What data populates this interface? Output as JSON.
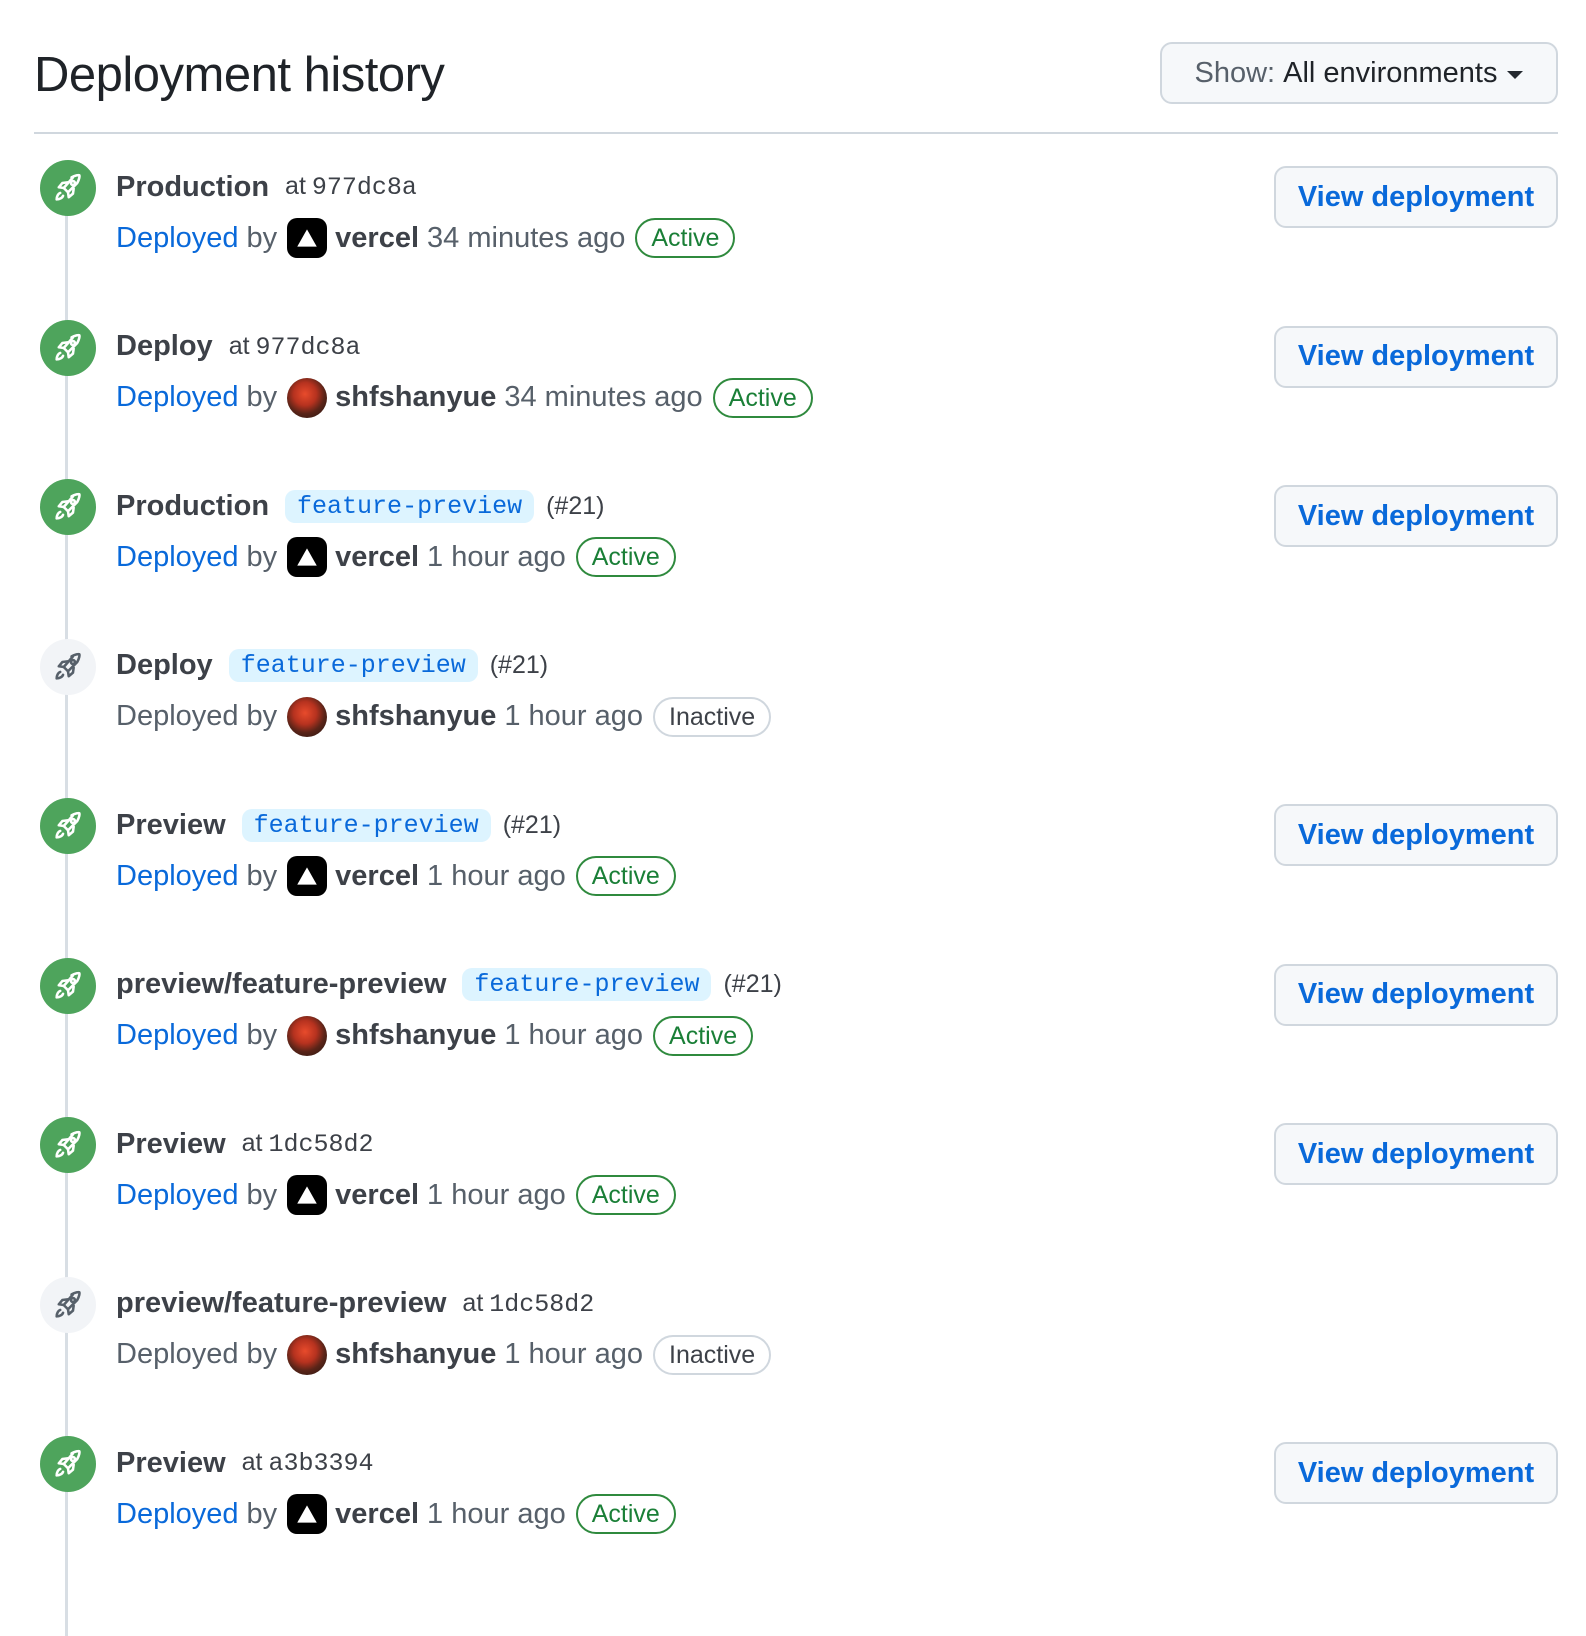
{
  "header": {
    "title": "Deployment history",
    "filter_prefix": "Show:",
    "filter_value": "All environments",
    "caret_icon": "caret-down-icon"
  },
  "deployed_label": "Deployed",
  "by_label": "by",
  "view_label": "View deployment",
  "colors": {
    "accent": "#0969da",
    "success": "#1a7f37",
    "icon_green": "#4ea45c"
  },
  "deployments": [
    {
      "env": "Production",
      "ref_kind": "sha",
      "at": "at",
      "sha": "977dc8a",
      "user": "vercel",
      "avatar": "vercel",
      "time": "34 minutes ago",
      "status": "Active",
      "active": true
    },
    {
      "env": "Deploy",
      "ref_kind": "sha",
      "at": "at",
      "sha": "977dc8a",
      "user": "shfshanyue",
      "avatar": "user",
      "time": "34 minutes ago",
      "status": "Active",
      "active": true
    },
    {
      "env": "Production",
      "ref_kind": "branch",
      "branch": "feature-preview",
      "pr": "(#21)",
      "user": "vercel",
      "avatar": "vercel",
      "time": "1 hour ago",
      "status": "Active",
      "active": true
    },
    {
      "env": "Deploy",
      "ref_kind": "branch",
      "branch": "feature-preview",
      "pr": "(#21)",
      "user": "shfshanyue",
      "avatar": "user",
      "time": "1 hour ago",
      "status": "Inactive",
      "active": false
    },
    {
      "env": "Preview",
      "ref_kind": "branch",
      "branch": "feature-preview",
      "pr": "(#21)",
      "user": "vercel",
      "avatar": "vercel",
      "time": "1 hour ago",
      "status": "Active",
      "active": true
    },
    {
      "env": "preview/feature-preview",
      "ref_kind": "branch",
      "branch": "feature-preview",
      "pr": "(#21)",
      "user": "shfshanyue",
      "avatar": "user",
      "time": "1 hour ago",
      "status": "Active",
      "active": true
    },
    {
      "env": "Preview",
      "ref_kind": "sha",
      "at": "at",
      "sha": "1dc58d2",
      "user": "vercel",
      "avatar": "vercel",
      "time": "1 hour ago",
      "status": "Active",
      "active": true
    },
    {
      "env": "preview/feature-preview",
      "ref_kind": "sha",
      "at": "at",
      "sha": "1dc58d2",
      "user": "shfshanyue",
      "avatar": "user",
      "time": "1 hour ago",
      "status": "Inactive",
      "active": false
    },
    {
      "env": "Preview",
      "ref_kind": "sha",
      "at": "at",
      "sha": "a3b3394",
      "user": "vercel",
      "avatar": "vercel",
      "time": "1 hour ago",
      "status": "Active",
      "active": true
    }
  ]
}
